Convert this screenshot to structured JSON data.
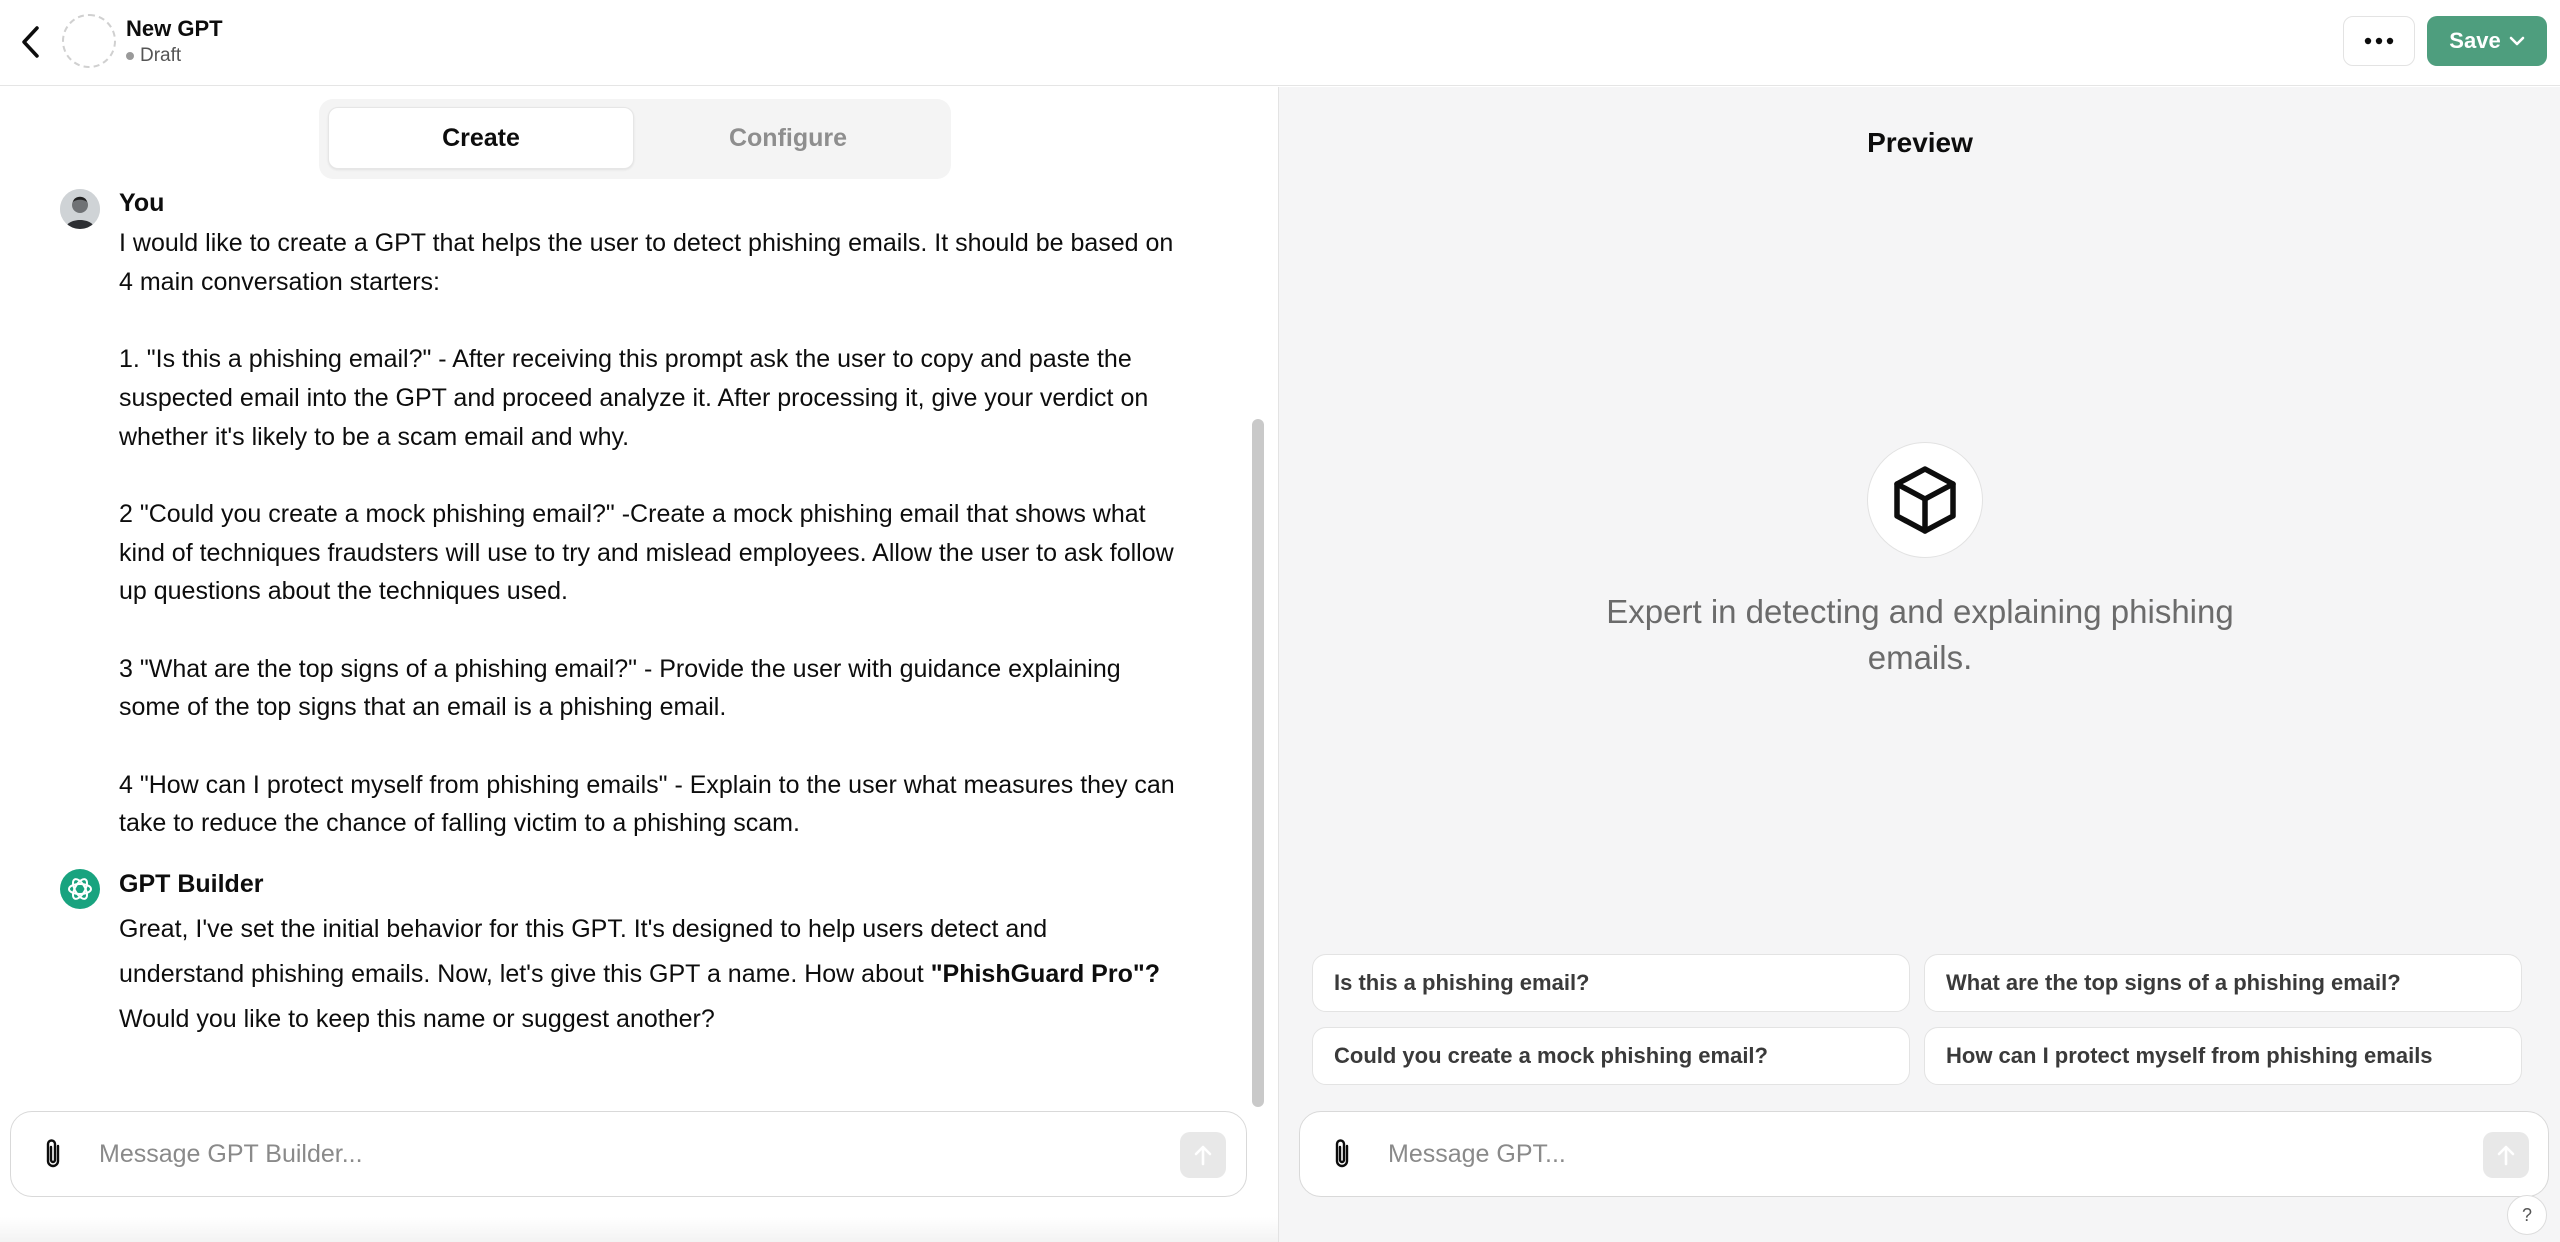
{
  "header": {
    "gpt_name": "New GPT",
    "status": "Draft",
    "save_label": "Save",
    "accent_color": "#4e9e7e"
  },
  "tabs": [
    {
      "label": "Create",
      "selected": true
    },
    {
      "label": "Configure",
      "selected": false
    }
  ],
  "chat": {
    "messages": [
      {
        "author": "You",
        "paragraphs": [
          [
            "I would like to create a GPT that helps the user to detect phishing emails.  It should be based on 4 main conversation starters:"
          ],
          [
            "1.  \"Is this a phishing email?\" - After receiving this prompt ask the user to copy and paste the suspected email into the GPT and proceed analyze it. After processing it, give your verdict on whether it's likely to be a scam email and why."
          ],
          [
            "2 \"Could you create a mock phishing email?\" -Create a mock phishing email that shows what kind of techniques fraudsters will use to try and mislead employees. Allow the user to ask follow up questions about the techniques used."
          ],
          [
            "3 \"What are the top signs of a phishing email?\" - Provide the user with guidance explaining some of the top signs that an email is a phishing email."
          ],
          [
            "4 \"How can I protect myself from phishing emails\" - Explain to the user what measures they can take to reduce the chance of falling victim to a phishing scam."
          ]
        ]
      },
      {
        "author": "GPT Builder",
        "text_before": "Great, I've set the initial behavior for this GPT. It's designed to help users detect and understand phishing emails. Now, let's give this GPT a name. How about ",
        "text_bold": "\"PhishGuard Pro\"?",
        "text_after": " Would you like to keep this name or suggest another?"
      }
    ]
  },
  "composer_left": {
    "placeholder": "Message GPT Builder..."
  },
  "preview": {
    "title": "Preview",
    "icon": "cube-icon",
    "description": "Expert in detecting and explaining phishing emails.",
    "starters": [
      "Is this a phishing email?",
      "What are the top signs of a phishing email?",
      "Could you create a mock phishing email?",
      "How can I protect myself from phishing emails"
    ],
    "composer_placeholder": "Message GPT...",
    "help_label": "?"
  }
}
